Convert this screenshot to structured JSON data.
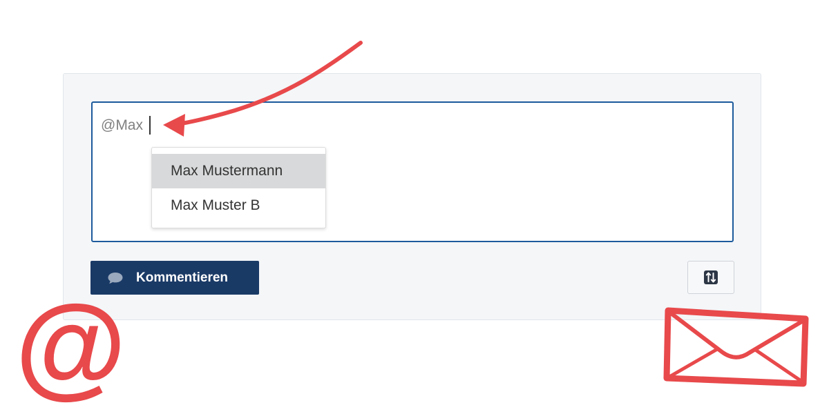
{
  "comment": {
    "input_value": "@Max"
  },
  "mention_suggestions": [
    {
      "label": "Max Mustermann",
      "selected": true
    },
    {
      "label": "Max Muster B",
      "selected": false
    }
  ],
  "actions": {
    "comment_button_label": "Kommentieren",
    "comment_icon": "speech-bubble-icon",
    "sort_icon": "sort-toggle-icon"
  },
  "decorations": {
    "at_symbol": "@",
    "accent_color": "#e8494b",
    "button_color": "#1a3a66",
    "focus_border_color": "#1c5a9c"
  }
}
